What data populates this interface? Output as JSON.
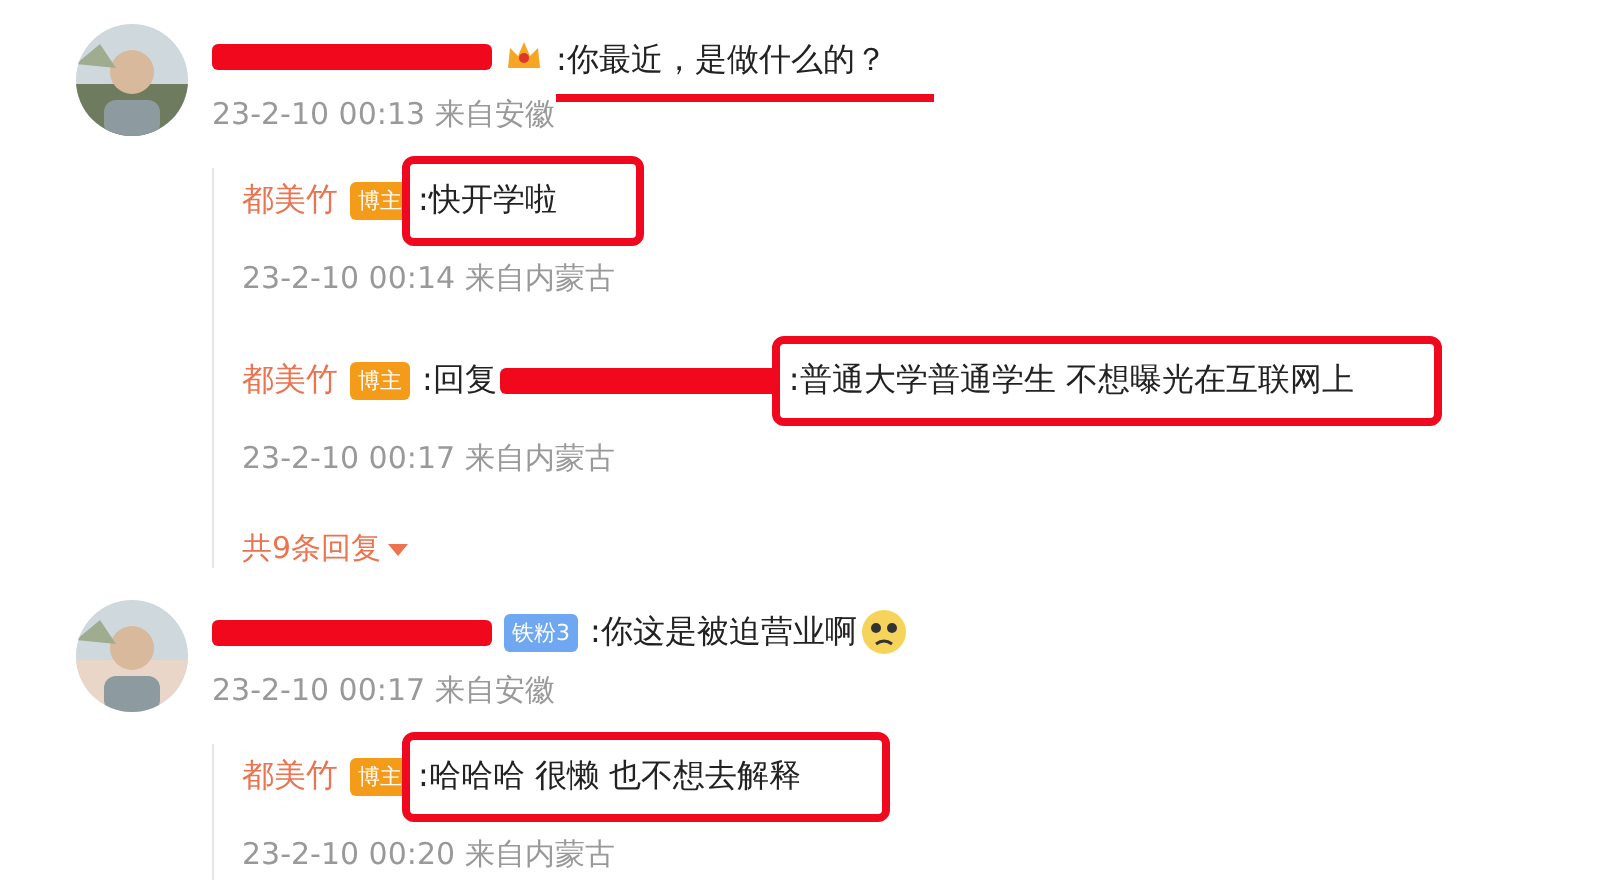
{
  "comments": [
    {
      "author_redacted": true,
      "badge": {
        "kind": "crown"
      },
      "text": ":你最近，是做什么的？",
      "underlined": true,
      "time": "23-2-10 00:13 来自安徽",
      "avatar": {
        "kind": "picture"
      },
      "replies": [
        {
          "author": "都美竹",
          "badge": "博主",
          "text": ":快开学啦",
          "boxed": true,
          "time": "23-2-10 00:14 来自内蒙古"
        },
        {
          "author": "都美竹",
          "badge": "博主",
          "prefix": ":回复",
          "mention_redacted": true,
          "text": ":普通大学普通学生 不想曝光在互联网上",
          "boxed": true,
          "time": "23-2-10 00:17 来自内蒙古"
        }
      ],
      "more": "共9条回复"
    },
    {
      "author_redacted": true,
      "badge": {
        "kind": "fan",
        "label": "铁粉3"
      },
      "text": ":你这是被迫营业啊",
      "emoji": true,
      "underlined": false,
      "time": "23-2-10 00:17 来自安徽",
      "avatar": {
        "kind": "picture"
      },
      "replies": [
        {
          "author": "都美竹",
          "badge": "博主",
          "text": ":哈哈哈 很懒 也不想去解释",
          "boxed": true,
          "time": "23-2-10 00:20 来自内蒙古"
        }
      ]
    }
  ]
}
